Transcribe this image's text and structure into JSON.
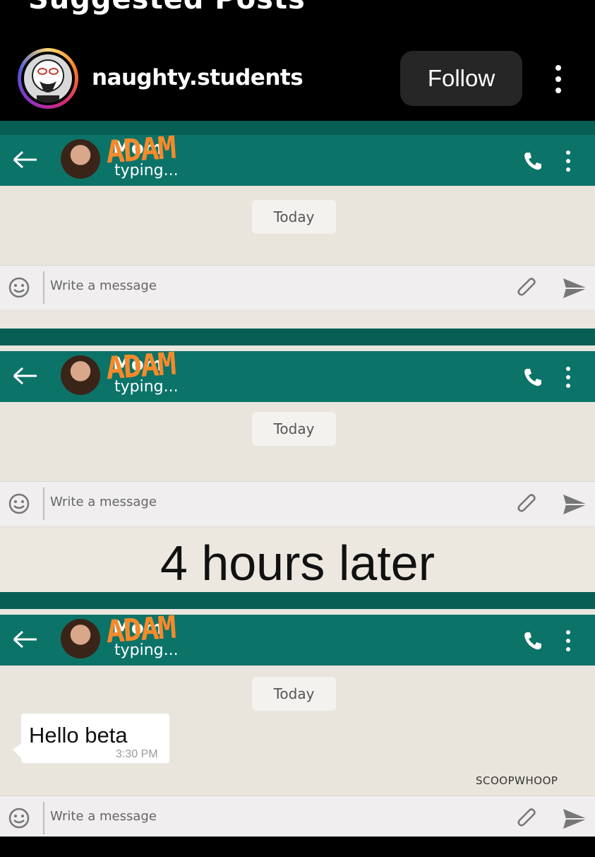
{
  "top_header": {
    "title": "Suggested Posts"
  },
  "post": {
    "username": "naughty.students",
    "follow_label": "Follow",
    "more_icon": "more-vertical-icon"
  },
  "meme": {
    "panels": [
      {
        "contact_name": "Mom",
        "scribble": "ADAM",
        "status": "typing...",
        "date_pill": "Today",
        "input_placeholder": "Write a message"
      },
      {
        "contact_name": "Mom",
        "scribble": "ADAM",
        "status": "typing...",
        "date_pill": "Today",
        "input_placeholder": "Write a message"
      },
      {
        "contact_name": "Mom",
        "scribble": "ADAM",
        "status": "typing...",
        "date_pill": "Today",
        "input_placeholder": "Write a message",
        "message": {
          "text": "Hello beta",
          "time": "3:30 PM"
        }
      }
    ],
    "caption": "4 hours later",
    "watermark": "SCOOPWHOOP"
  },
  "colors": {
    "wa_header": "#0c7369",
    "wa_status_bar": "#075e54",
    "chat_bg": "#e9e5dc",
    "scribble": "#f58a2a",
    "follow_bg": "#262626"
  }
}
